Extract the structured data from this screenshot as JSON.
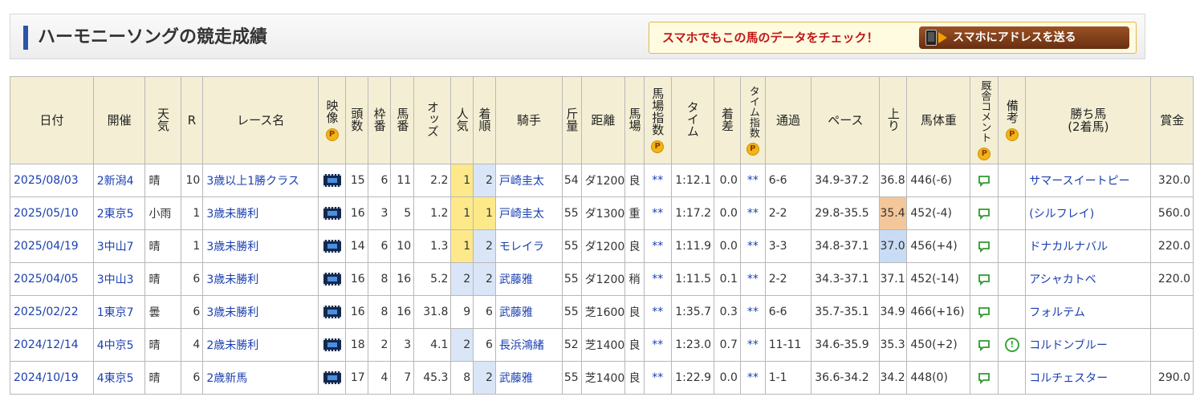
{
  "header": {
    "title": "ハーモニーソングの競走成績",
    "banner_text": "スマホでもこの馬のデータをチェック！",
    "banner_button": "スマホにアドレスを送る"
  },
  "table": {
    "headers": {
      "date": "日付",
      "venue": "開催",
      "weather": "天気",
      "race_no": "R",
      "race_name": "レース名",
      "video": "映像",
      "field_size": "頭数",
      "frame": "枠番",
      "horse_no": "馬番",
      "odds": "オッズ",
      "popularity": "人気",
      "finish": "着順",
      "jockey": "騎手",
      "weight_carried": "斤量",
      "distance": "距離",
      "track": "馬場",
      "track_index": "馬場指数",
      "time": "タイム",
      "margin": "着差",
      "time_index": "タイム指数",
      "passing": "通過",
      "pace": "ペース",
      "last3f": "上り",
      "body_weight": "馬体重",
      "stable_comment": "厩舎コメント",
      "remarks": "備考",
      "winner": "勝ち馬(2着馬)",
      "prize": "賞金",
      "p_badge": "P"
    },
    "rows": [
      {
        "date": "2025/08/03",
        "venue": "2新潟4",
        "weather": "晴",
        "race_no": "10",
        "race_name": "3歳以上1勝クラス",
        "field_size": "15",
        "frame": "6",
        "horse_no": "11",
        "odds": "2.2",
        "popularity": "1",
        "finish": "2",
        "jockey": "戸崎圭太",
        "weight_carried": "54",
        "distance": "ダ1200",
        "track": "良",
        "track_index": "**",
        "time": "1:12.1",
        "margin": "0.0",
        "time_index": "**",
        "passing": "6-6",
        "pace": "34.9-37.2",
        "last3f": "36.8",
        "body_weight": "446(-6)",
        "remarks": "",
        "winner": "サマースイートピー",
        "prize": "320.0"
      },
      {
        "date": "2025/05/10",
        "venue": "2東京5",
        "weather": "小雨",
        "race_no": "1",
        "race_name": "3歳未勝利",
        "field_size": "16",
        "frame": "3",
        "horse_no": "5",
        "odds": "1.2",
        "popularity": "1",
        "finish": "1",
        "jockey": "戸崎圭太",
        "weight_carried": "55",
        "distance": "ダ1300",
        "track": "重",
        "track_index": "**",
        "time": "1:17.2",
        "margin": "0.0",
        "time_index": "**",
        "passing": "2-2",
        "pace": "29.8-35.5",
        "last3f": "35.4",
        "body_weight": "452(-4)",
        "remarks": "",
        "winner": "(シルフレイ)",
        "prize": "560.0"
      },
      {
        "date": "2025/04/19",
        "venue": "3中山7",
        "weather": "晴",
        "race_no": "1",
        "race_name": "3歳未勝利",
        "field_size": "14",
        "frame": "6",
        "horse_no": "10",
        "odds": "1.3",
        "popularity": "1",
        "finish": "2",
        "jockey": "モレイラ",
        "weight_carried": "55",
        "distance": "ダ1200",
        "track": "良",
        "track_index": "**",
        "time": "1:11.9",
        "margin": "0.0",
        "time_index": "**",
        "passing": "3-3",
        "pace": "34.8-37.1",
        "last3f": "37.0",
        "body_weight": "456(+4)",
        "remarks": "",
        "winner": "ドナカルナバル",
        "prize": "220.0"
      },
      {
        "date": "2025/04/05",
        "venue": "3中山3",
        "weather": "晴",
        "race_no": "6",
        "race_name": "3歳未勝利",
        "field_size": "16",
        "frame": "8",
        "horse_no": "16",
        "odds": "5.2",
        "popularity": "2",
        "finish": "2",
        "jockey": "武藤雅",
        "weight_carried": "55",
        "distance": "ダ1200",
        "track": "稍",
        "track_index": "**",
        "time": "1:11.5",
        "margin": "0.1",
        "time_index": "**",
        "passing": "2-2",
        "pace": "34.3-37.1",
        "last3f": "37.1",
        "body_weight": "452(-14)",
        "remarks": "",
        "winner": "アシャカトベ",
        "prize": "220.0"
      },
      {
        "date": "2025/02/22",
        "venue": "1東京7",
        "weather": "曇",
        "race_no": "6",
        "race_name": "3歳未勝利",
        "field_size": "16",
        "frame": "8",
        "horse_no": "16",
        "odds": "31.8",
        "popularity": "9",
        "finish": "6",
        "jockey": "武藤雅",
        "weight_carried": "55",
        "distance": "芝1600",
        "track": "良",
        "track_index": "**",
        "time": "1:35.7",
        "margin": "0.3",
        "time_index": "**",
        "passing": "6-6",
        "pace": "35.7-35.1",
        "last3f": "34.9",
        "body_weight": "466(+16)",
        "remarks": "",
        "winner": "フォルテム",
        "prize": ""
      },
      {
        "date": "2024/12/14",
        "venue": "4中京5",
        "weather": "晴",
        "race_no": "4",
        "race_name": "2歳未勝利",
        "field_size": "18",
        "frame": "2",
        "horse_no": "3",
        "odds": "4.1",
        "popularity": "2",
        "finish": "6",
        "jockey": "長浜鴻緒",
        "weight_carried": "52",
        "distance": "芝1400",
        "track": "良",
        "track_index": "**",
        "time": "1:23.0",
        "margin": "0.7",
        "time_index": "**",
        "passing": "11-11",
        "pace": "34.6-35.9",
        "last3f": "35.3",
        "body_weight": "450(+2)",
        "remarks": "!",
        "winner": "コルドンブルー",
        "prize": ""
      },
      {
        "date": "2024/10/19",
        "venue": "4東京5",
        "weather": "晴",
        "race_no": "6",
        "race_name": "2歳新馬",
        "field_size": "17",
        "frame": "4",
        "horse_no": "7",
        "odds": "45.3",
        "popularity": "8",
        "finish": "2",
        "jockey": "武藤雅",
        "weight_carried": "55",
        "distance": "芝1400",
        "track": "良",
        "track_index": "**",
        "time": "1:22.9",
        "margin": "0.0",
        "time_index": "**",
        "passing": "1-1",
        "pace": "36.6-34.2",
        "last3f": "34.2",
        "body_weight": "448(0)",
        "remarks": "",
        "winner": "コルチェスター",
        "prize": "290.0"
      }
    ]
  },
  "colors": {
    "header_bg": "#f4efd4",
    "link": "#1a3fb0",
    "popularity_highlight": "#fde98a",
    "finish_highlight": "#dae6f7",
    "last3f_rank1": "#f3c799",
    "last3f_rank2": "#c9dcf5",
    "title_accent": "#2a55a8",
    "banner_text": "#c01818"
  },
  "icons": {
    "video": "film-icon",
    "stable_comment": "comment-icon",
    "remarks": "exclamation-circle-icon",
    "p_badge": "p-badge-icon",
    "phone": "smartphone-icon"
  }
}
